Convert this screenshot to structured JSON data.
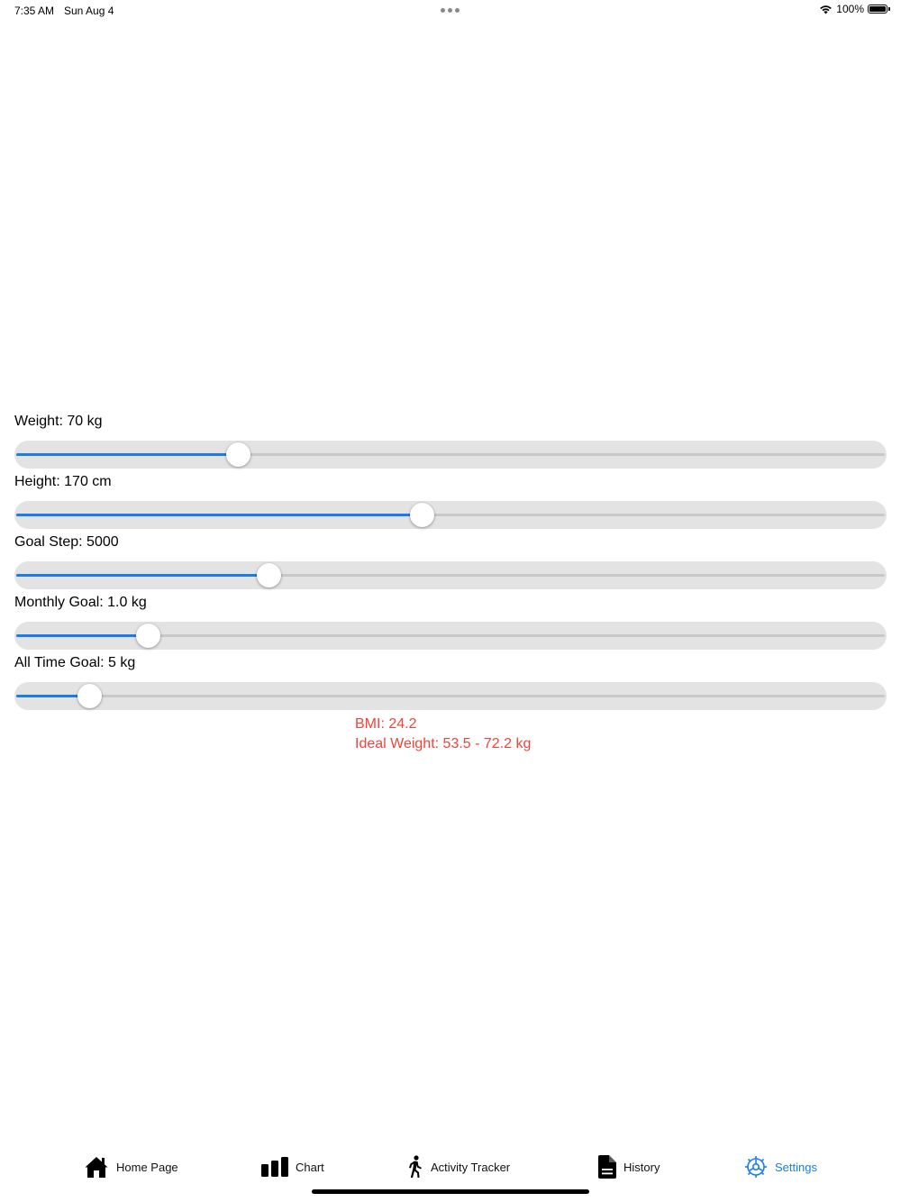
{
  "status_bar": {
    "time": "7:35 AM",
    "date": "Sun Aug 4",
    "battery_text": "100%",
    "battery_level": 1.0
  },
  "settings": [
    {
      "label": "Weight: 70 kg",
      "fill": 0.256
    },
    {
      "label": "Height: 170 cm",
      "fill": 0.467
    },
    {
      "label": "Goal Step: 5000",
      "fill": 0.291
    },
    {
      "label": "Monthly Goal: 1.0 kg",
      "fill": 0.152
    },
    {
      "label": "All Time Goal: 5 kg",
      "fill": 0.085
    }
  ],
  "results": {
    "bmi": "BMI: 24.2",
    "ideal_weight": "Ideal Weight: 53.5 - 72.2 kg"
  },
  "tabs": [
    {
      "label": "Home Page",
      "icon": "house-icon"
    },
    {
      "label": "Chart",
      "icon": "bar-chart-icon"
    },
    {
      "label": "Activity Tracker",
      "icon": "walking-figure-icon"
    },
    {
      "label": "History",
      "icon": "document-icon"
    },
    {
      "label": "Settings",
      "icon": "gear-icon",
      "active": true
    }
  ],
  "colors": {
    "accent": "#1a7cf0",
    "result_text": "#f0433a",
    "slider_background": "#e3e3e3",
    "track": "#c8c8c8"
  }
}
